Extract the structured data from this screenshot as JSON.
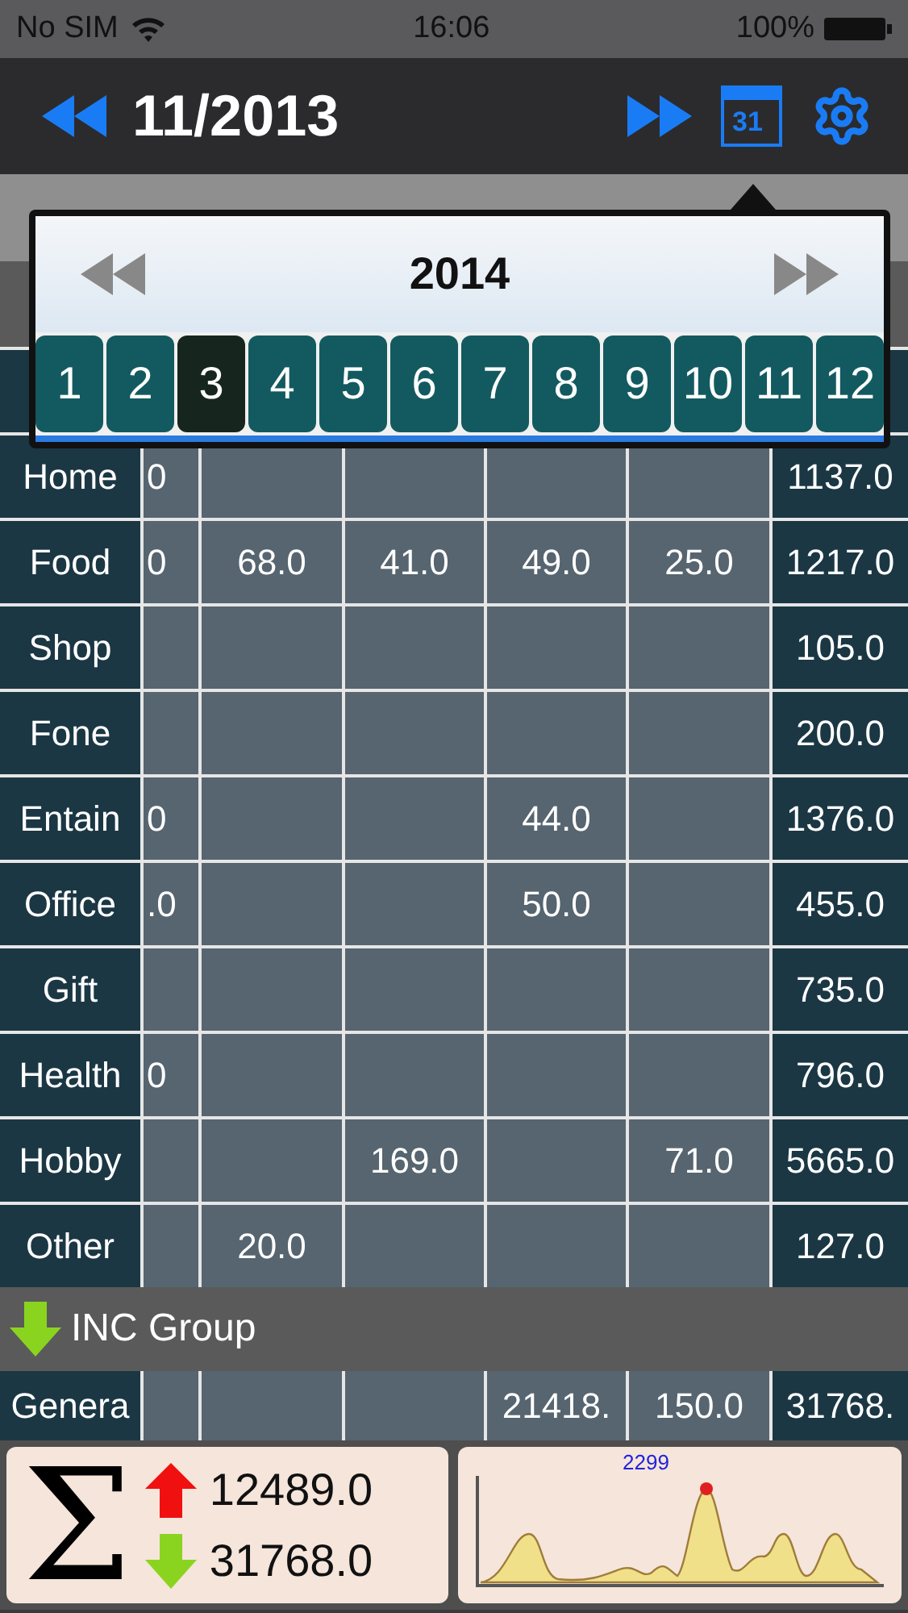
{
  "status_bar": {
    "carrier": "No SIM",
    "time": "16:06",
    "battery": "100%"
  },
  "nav": {
    "title": "11/2013",
    "calendar_day": "31"
  },
  "month_picker": {
    "year": "2014",
    "months": [
      {
        "label": "1",
        "selected": false
      },
      {
        "label": "2",
        "selected": false
      },
      {
        "label": "3",
        "selected": true
      },
      {
        "label": "4",
        "selected": false
      },
      {
        "label": "5",
        "selected": false
      },
      {
        "label": "6",
        "selected": false
      },
      {
        "label": "7",
        "selected": false
      },
      {
        "label": "8",
        "selected": false
      },
      {
        "label": "9",
        "selected": false
      },
      {
        "label": "10",
        "selected": false
      },
      {
        "label": "11",
        "selected": false
      },
      {
        "label": "12",
        "selected": false
      }
    ]
  },
  "expense_rows": [
    {
      "name": "Home",
      "cells": [
        "0",
        null,
        null,
        null,
        null
      ],
      "total": "1137.0"
    },
    {
      "name": "Food",
      "cells": [
        "0",
        "68.0",
        "41.0",
        "49.0",
        "25.0"
      ],
      "total": "1217.0"
    },
    {
      "name": "Shop",
      "cells": [
        null,
        null,
        null,
        null,
        null
      ],
      "total": "105.0"
    },
    {
      "name": "Fone",
      "cells": [
        null,
        null,
        null,
        null,
        null
      ],
      "total": "200.0"
    },
    {
      "name": "Entain",
      "cells": [
        "0",
        null,
        null,
        "44.0",
        null
      ],
      "total": "1376.0"
    },
    {
      "name": "Office",
      "cells": [
        ".0",
        null,
        null,
        "50.0",
        null
      ],
      "total": "455.0"
    },
    {
      "name": "Gift",
      "cells": [
        null,
        null,
        null,
        null,
        null
      ],
      "total": "735.0"
    },
    {
      "name": "Health",
      "cells": [
        "0",
        null,
        null,
        null,
        null
      ],
      "total": "796.0"
    },
    {
      "name": "Hobby",
      "cells": [
        null,
        null,
        "169.0",
        null,
        "71.0"
      ],
      "total": "5665.0"
    },
    {
      "name": "Other",
      "cells": [
        null,
        "20.0",
        null,
        null,
        null
      ],
      "total": "127.0"
    }
  ],
  "income_group": {
    "label": "INC Group"
  },
  "income_rows": [
    {
      "name": "Genera",
      "cells": [
        null,
        null,
        null,
        "21418.",
        "150.0"
      ],
      "total": "31768."
    }
  ],
  "summary": {
    "sum_symbol": "Σ",
    "expense_total": "12489.0",
    "income_total": "31768.0",
    "peak_label": "2299"
  }
}
